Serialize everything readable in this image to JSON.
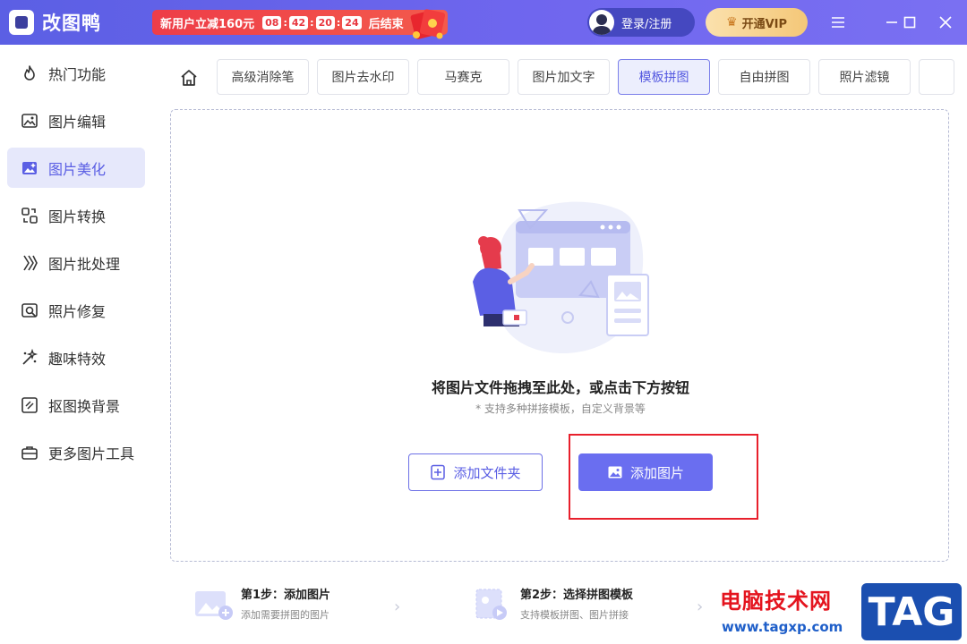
{
  "app": {
    "name": "改图鸭"
  },
  "promo": {
    "text": "新用户立减160元",
    "countdown": [
      "08",
      "42",
      "20",
      "24"
    ],
    "suffix": "后结束"
  },
  "header": {
    "login_label": "登录/注册",
    "vip_label": "开通VIP",
    "vip_icon": "crown-icon"
  },
  "sidebar": {
    "items": [
      {
        "label": "热门功能",
        "icon": "fire-icon"
      },
      {
        "label": "图片编辑",
        "icon": "image-edit-icon"
      },
      {
        "label": "图片美化",
        "icon": "image-beautify-icon",
        "active": true
      },
      {
        "label": "图片转换",
        "icon": "convert-icon"
      },
      {
        "label": "图片批处理",
        "icon": "batch-icon"
      },
      {
        "label": "照片修复",
        "icon": "repair-icon"
      },
      {
        "label": "趣味特效",
        "icon": "sparkle-icon"
      },
      {
        "label": "抠图换背景",
        "icon": "cutout-icon"
      },
      {
        "label": "更多图片工具",
        "icon": "toolbox-icon"
      }
    ]
  },
  "tabs": [
    {
      "label": "高级消除笔"
    },
    {
      "label": "图片去水印"
    },
    {
      "label": "马赛克"
    },
    {
      "label": "图片加文字"
    },
    {
      "label": "模板拼图",
      "active": true
    },
    {
      "label": "自由拼图"
    },
    {
      "label": "照片滤镜"
    }
  ],
  "dropzone": {
    "title": "将图片文件拖拽至此处，或点击下方按钮",
    "subtitle": "* 支持多种拼接模板，自定义背景等",
    "add_folder_label": "添加文件夹",
    "add_image_label": "添加图片"
  },
  "steps": [
    {
      "title": "第1步：添加图片",
      "desc": "添加需要拼图的图片"
    },
    {
      "title": "第2步：选择拼图模板",
      "desc": "支持模板拼图、图片拼接"
    }
  ],
  "watermark": {
    "site_cn": "电脑技术网",
    "url": "www.tagxp.com",
    "tag": "TAG"
  },
  "colors": {
    "accent": "#5b5fe4",
    "highlight": "#e8202c"
  }
}
